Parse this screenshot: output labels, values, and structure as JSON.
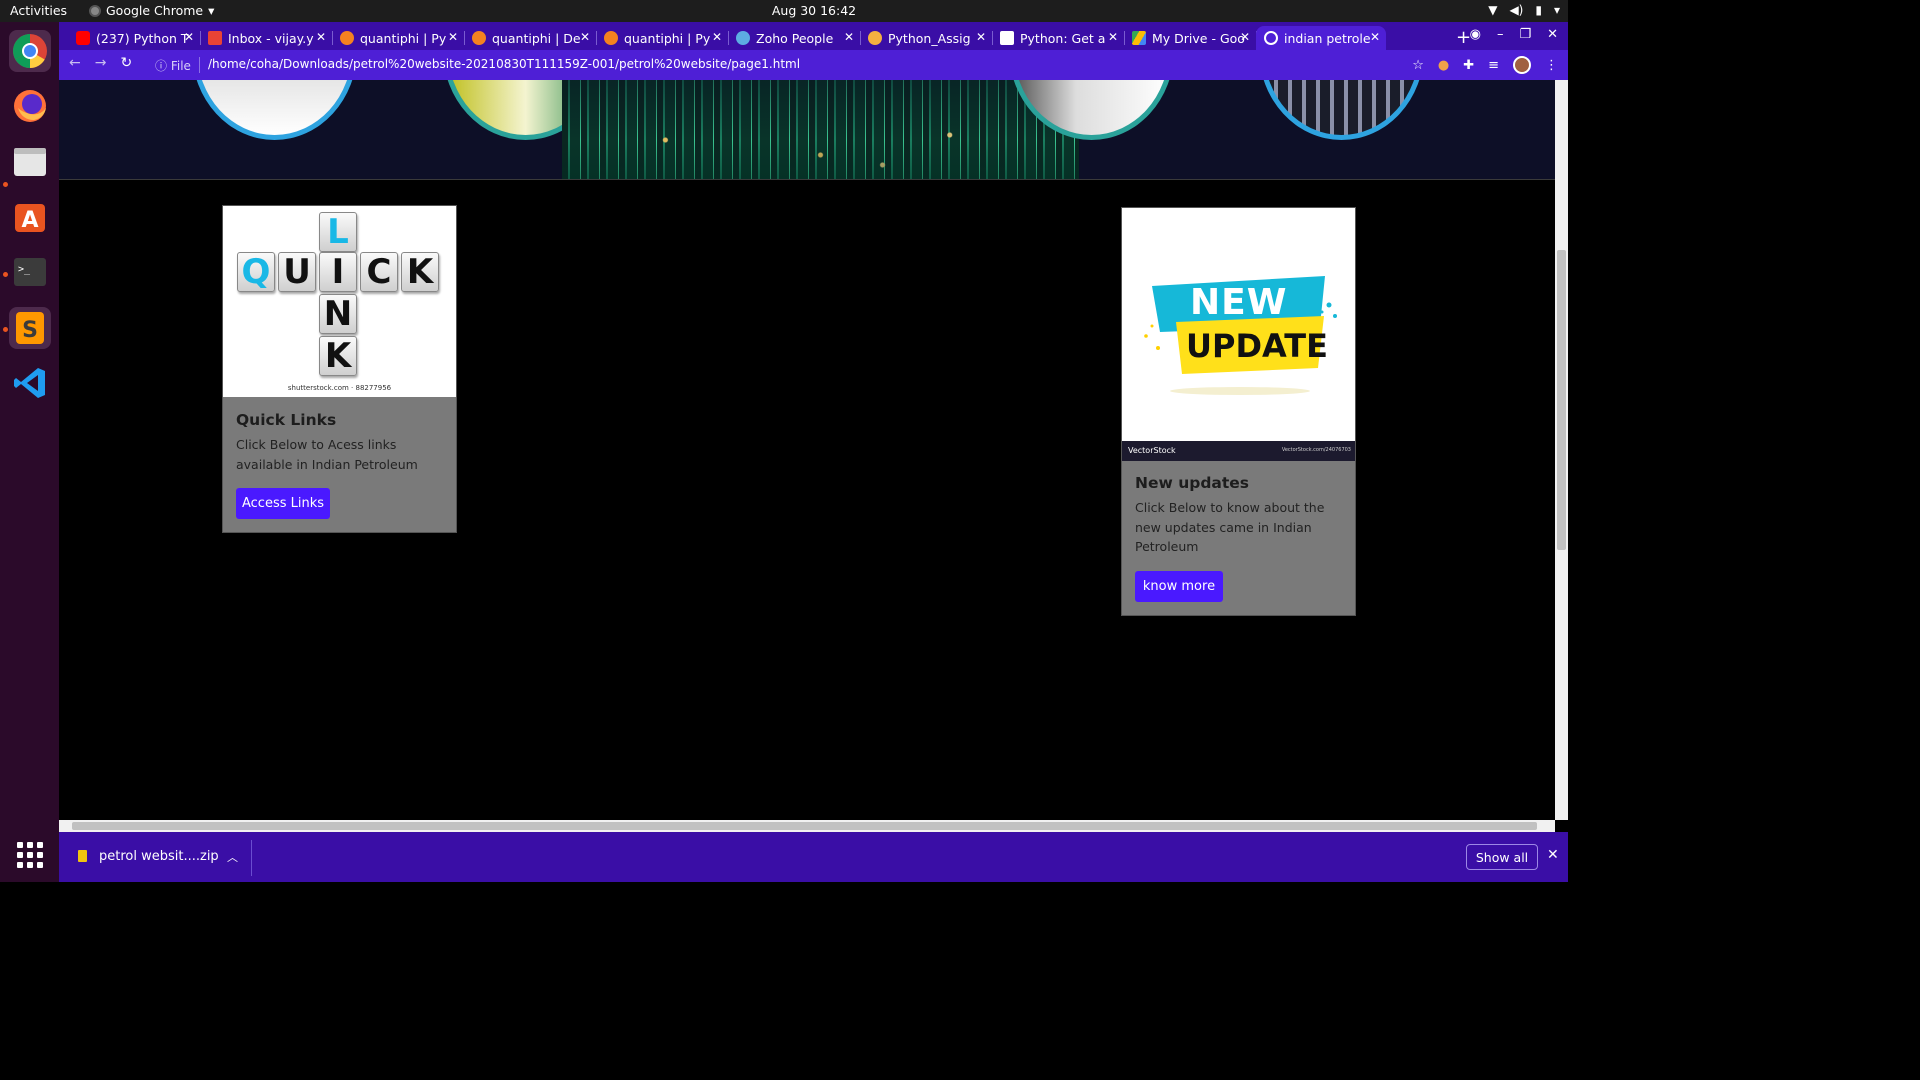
{
  "topbar": {
    "activities": "Activities",
    "app_name": "Google Chrome",
    "clock": "Aug 30  16:42"
  },
  "tabs": [
    {
      "title": "(237) Python T",
      "favicon_color": "#ff0000",
      "favicon": "youtube-icon"
    },
    {
      "title": "Inbox - vijay.y",
      "favicon_color": "#ea4335",
      "favicon": "gmail-icon"
    },
    {
      "title": "quantiphi | Py",
      "favicon_color": "#f58220",
      "favicon": "quantiphi-icon"
    },
    {
      "title": "quantiphi | De",
      "favicon_color": "#f58220",
      "favicon": "quantiphi-icon"
    },
    {
      "title": "quantiphi | Py",
      "favicon_color": "#f58220",
      "favicon": "quantiphi-icon"
    },
    {
      "title": "Zoho People",
      "favicon_color": "#5dade2",
      "favicon": "zoho-icon"
    },
    {
      "title": "Python_Assig",
      "favicon_color": "#f5b041",
      "favicon": "colab-icon"
    },
    {
      "title": "Python: Get a",
      "favicon_color": "#ffffff",
      "favicon": "w3-icon"
    },
    {
      "title": "My Drive - Goo",
      "favicon_color": "#34a853",
      "favicon": "drive-icon"
    },
    {
      "title": "indian petrole",
      "favicon_color": "#ffffff",
      "favicon": "globe-icon",
      "active": true
    }
  ],
  "address_bar": {
    "scheme_label": "File",
    "url": "/home/coha/Downloads/petrol%20website-20210830T111159Z-001/petrol%20website/page1.html"
  },
  "cards": {
    "quick_links": {
      "title": "Quick Links",
      "text": "Click Below to Acess links available in Indian Petroleum",
      "button": "Access Links",
      "image_credit": "shutterstock.com · 88277956",
      "tiles": [
        "L",
        "Q",
        "U",
        "I",
        "C",
        "K",
        "N",
        "K"
      ]
    },
    "new_updates": {
      "title": "New updates",
      "text": "Click Below to know about the new updates came in Indian Petroleum",
      "button": "know more",
      "banner_top": "NEW",
      "banner_bottom": "UPDATE",
      "image_credit": "VectorStock",
      "image_credit_right": "VectorStock.com/24076703"
    }
  },
  "download_shelf": {
    "filename": "petrol websit....zip",
    "show_all": "Show all"
  },
  "colors": {
    "tab_strip": "#3a0ea6",
    "toolbar": "#4e1fd6",
    "button": "#4a19ff",
    "card_bg": "#7a7a7a",
    "ring": "#2ea3e0"
  }
}
